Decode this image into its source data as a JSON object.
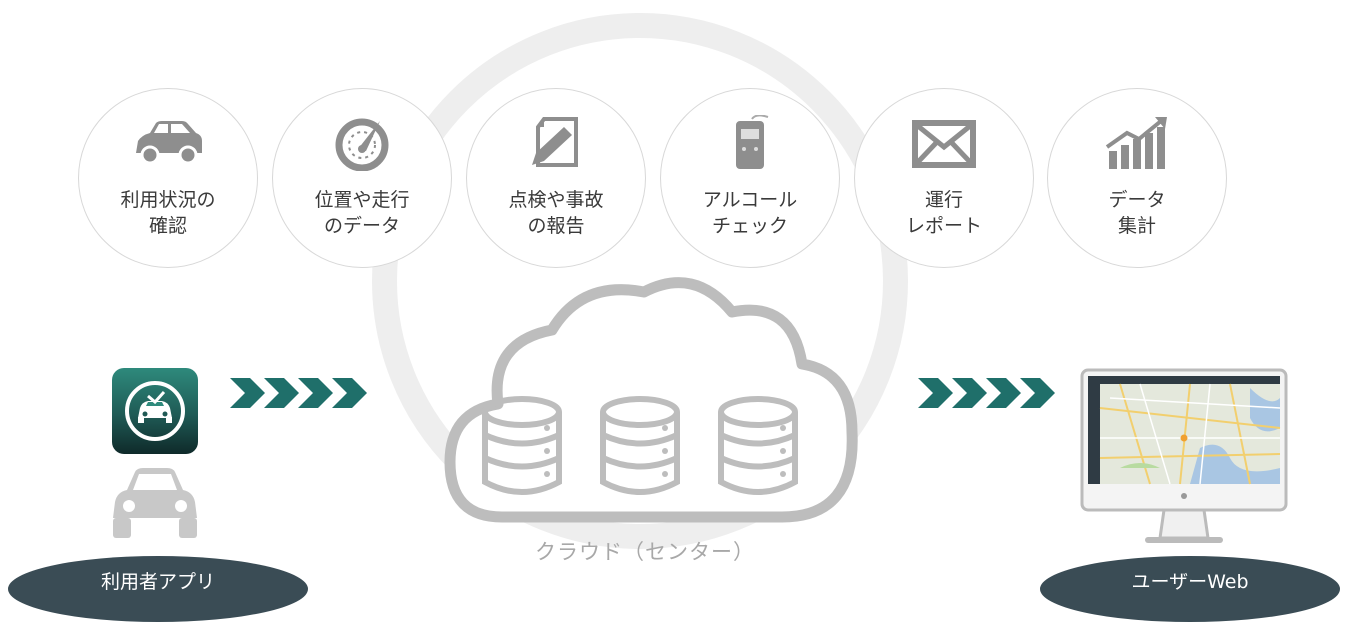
{
  "features": [
    {
      "label": "利用状況の\n確認",
      "icon": "car-icon"
    },
    {
      "label": "位置や走行\nのデータ",
      "icon": "speedometer-icon"
    },
    {
      "label": "点検や事故\nの報告",
      "icon": "edit-report-icon"
    },
    {
      "label": "アルコール\nチェック",
      "icon": "breathalyzer-icon"
    },
    {
      "label": "運行\nレポート",
      "icon": "mail-icon"
    },
    {
      "label": "データ\n集計",
      "icon": "growth-chart-icon"
    }
  ],
  "cloud": {
    "caption": "クラウド（センター）",
    "icon": "cloud-database-icon"
  },
  "left_node": {
    "label": "利用者アプリ",
    "icons": [
      "app-icon",
      "car-icon"
    ]
  },
  "right_node": {
    "label": "ユーザーWeb",
    "icon": "monitor-map-icon"
  },
  "colors": {
    "accent": "#1f6f6a",
    "pill": "#3a4c55",
    "ring": "#eeeeee",
    "icon_gray": "#9a9a9a"
  }
}
